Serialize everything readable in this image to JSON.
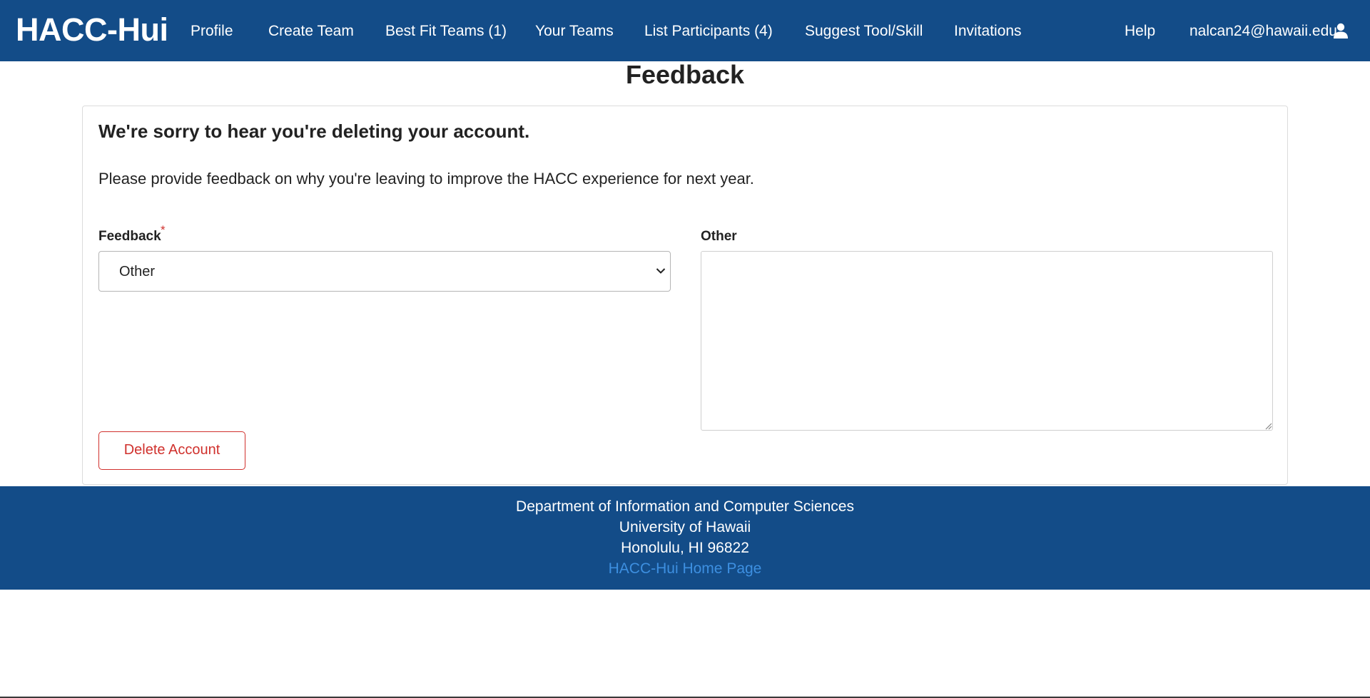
{
  "navbar": {
    "brand": "HACC-Hui",
    "items": [
      {
        "label": "Profile"
      },
      {
        "label": "Create Team"
      },
      {
        "label": "Best Fit Teams (1)"
      },
      {
        "label": "Your Teams"
      },
      {
        "label": "List Participants (4)"
      },
      {
        "label": "Suggest Tool/Skill"
      },
      {
        "label": "Invitations"
      }
    ],
    "help": "Help",
    "user_email": "nalcan24@hawaii.edu",
    "user_icon": "user-icon"
  },
  "page": {
    "title": "Feedback"
  },
  "card": {
    "heading": "We're sorry to hear you're deleting your account.",
    "subtext": "Please provide feedback on why you're leaving to improve the HACC experience for next year.",
    "feedback_label": "Feedback",
    "required_marker": "*",
    "feedback_selected": "Other",
    "other_label": "Other",
    "other_value": "",
    "delete_button": "Delete Account"
  },
  "footer": {
    "line1": "Department of Information and Computer Sciences",
    "line2": "University of Hawaii",
    "line3": "Honolulu, HI 96822",
    "link": "HACC-Hui Home Page"
  },
  "colors": {
    "brand_blue": "#134c88",
    "danger": "#d0312d",
    "link": "#3d8fe0"
  }
}
